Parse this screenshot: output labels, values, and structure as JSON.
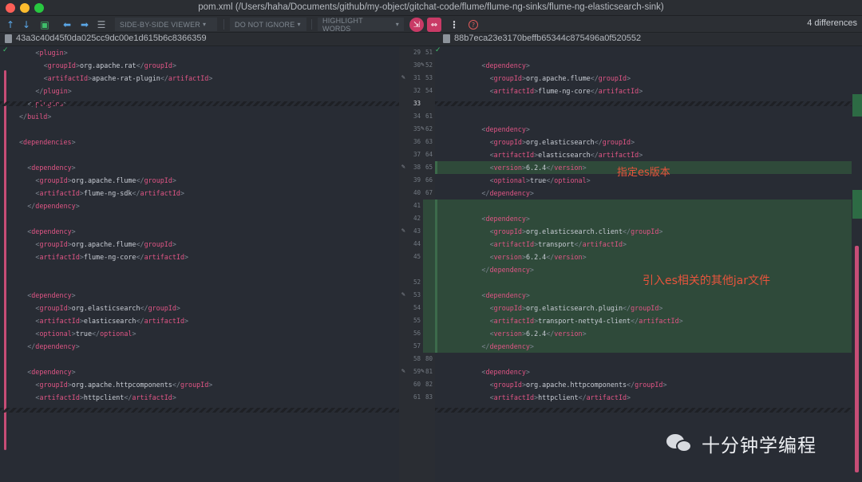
{
  "window": {
    "title": "pom.xml (/Users/haha/Documents/github/my-object/gitchat-code/flume/flume-ng-sinks/flume-ng-elasticsearch-sink)"
  },
  "toolbar": {
    "viewer_label": "SIDE-BY-SIDE VIEWER",
    "ignore_label": "DO NOT IGNORE",
    "highlight_label": "HIGHLIGHT WORDS",
    "diff_count": "4 differences"
  },
  "revisions": {
    "left_hash": "43a3c40d45f0da025cc9dc00e1d615b6c8366359",
    "right_hash": "88b7eca23e3170beffb65344c875496a0f520552"
  },
  "left_lines": [
    {
      "n": "29",
      "indent": 4,
      "parts": [
        [
          "<",
          "br"
        ],
        [
          "plugin",
          "tag"
        ],
        [
          ">",
          "br"
        ]
      ]
    },
    {
      "n": "30",
      "indent": 6,
      "parts": [
        [
          "<",
          "br"
        ],
        [
          "groupId",
          "tag"
        ],
        [
          ">",
          "br"
        ],
        [
          "org.apache.rat",
          "txt"
        ],
        [
          "</",
          "br"
        ],
        [
          "groupId",
          "tag"
        ],
        [
          ">",
          "br"
        ]
      ]
    },
    {
      "n": "31",
      "indent": 6,
      "parts": [
        [
          "<",
          "br"
        ],
        [
          "artifactId",
          "tag"
        ],
        [
          ">",
          "br"
        ],
        [
          "apache-rat-plugin",
          "txt"
        ],
        [
          "</",
          "br"
        ],
        [
          "artifactId",
          "tag"
        ],
        [
          ">",
          "br"
        ]
      ]
    },
    {
      "n": "32",
      "indent": 4,
      "parts": [
        [
          "</",
          "br"
        ],
        [
          "plugin",
          "tag"
        ],
        [
          ">",
          "br"
        ]
      ]
    },
    {
      "n": "33",
      "indent": 2,
      "parts": [
        [
          "</",
          "br"
        ],
        [
          "plugins",
          "tag"
        ],
        [
          ">",
          "br"
        ]
      ]
    },
    {
      "n": "34",
      "indent": 0,
      "parts": [
        [
          "</",
          "br"
        ],
        [
          "build",
          "tag"
        ],
        [
          ">",
          "br"
        ]
      ]
    },
    {
      "n": "35",
      "indent": 0,
      "parts": []
    },
    {
      "n": "36",
      "indent": 0,
      "parts": [
        [
          "<",
          "br"
        ],
        [
          "dependencies",
          "tag"
        ],
        [
          ">",
          "br"
        ]
      ]
    },
    {
      "n": "37",
      "indent": 0,
      "parts": []
    },
    {
      "n": "38",
      "indent": 2,
      "parts": [
        [
          "<",
          "br"
        ],
        [
          "dependency",
          "tag"
        ],
        [
          ">",
          "br"
        ]
      ]
    },
    {
      "n": "39",
      "indent": 4,
      "parts": [
        [
          "<",
          "br"
        ],
        [
          "groupId",
          "tag"
        ],
        [
          ">",
          "br"
        ],
        [
          "org.apache.flume",
          "txt"
        ],
        [
          "</",
          "br"
        ],
        [
          "groupId",
          "tag"
        ],
        [
          ">",
          "br"
        ]
      ]
    },
    {
      "n": "40",
      "indent": 4,
      "parts": [
        [
          "<",
          "br"
        ],
        [
          "artifactId",
          "tag"
        ],
        [
          ">",
          "br"
        ],
        [
          "flume-ng-sdk",
          "txt"
        ],
        [
          "</",
          "br"
        ],
        [
          "artifactId",
          "tag"
        ],
        [
          ">",
          "br"
        ]
      ]
    },
    {
      "n": "41",
      "indent": 2,
      "parts": [
        [
          "</",
          "br"
        ],
        [
          "dependency",
          "tag"
        ],
        [
          ">",
          "br"
        ]
      ]
    },
    {
      "n": "42",
      "indent": 0,
      "parts": []
    },
    {
      "n": "43",
      "indent": 2,
      "parts": [
        [
          "<",
          "br"
        ],
        [
          "dependency",
          "tag"
        ],
        [
          ">",
          "br"
        ]
      ]
    },
    {
      "n": "44",
      "indent": 4,
      "parts": [
        [
          "<",
          "br"
        ],
        [
          "groupId",
          "tag"
        ],
        [
          ">",
          "br"
        ],
        [
          "org.apache.flume",
          "txt"
        ],
        [
          "</",
          "br"
        ],
        [
          "groupId",
          "tag"
        ],
        [
          ">",
          "br"
        ]
      ]
    },
    {
      "n": "45",
      "indent": 4,
      "parts": [
        [
          "<",
          "br"
        ],
        [
          "artifactId",
          "tag"
        ],
        [
          ">",
          "br"
        ],
        [
          "flume-ng-core",
          "txt"
        ],
        [
          "</",
          "br"
        ],
        [
          "artifactId",
          "tag"
        ],
        [
          ">",
          "br"
        ]
      ]
    },
    {
      "n": "",
      "indent": 0,
      "parts": []
    },
    {
      "n": "52",
      "indent": 0,
      "parts": []
    },
    {
      "n": "53",
      "indent": 2,
      "parts": [
        [
          "<",
          "br"
        ],
        [
          "dependency",
          "tag"
        ],
        [
          ">",
          "br"
        ]
      ]
    },
    {
      "n": "54",
      "indent": 4,
      "parts": [
        [
          "<",
          "br"
        ],
        [
          "groupId",
          "tag"
        ],
        [
          ">",
          "br"
        ],
        [
          "org.elasticsearch",
          "txt"
        ],
        [
          "</",
          "br"
        ],
        [
          "groupId",
          "tag"
        ],
        [
          ">",
          "br"
        ]
      ]
    },
    {
      "n": "55",
      "indent": 4,
      "parts": [
        [
          "<",
          "br"
        ],
        [
          "artifactId",
          "tag"
        ],
        [
          ">",
          "br"
        ],
        [
          "elasticsearch",
          "txt"
        ],
        [
          "</",
          "br"
        ],
        [
          "artifactId",
          "tag"
        ],
        [
          ">",
          "br"
        ]
      ]
    },
    {
      "n": "56",
      "indent": 4,
      "parts": [
        [
          "<",
          "br"
        ],
        [
          "optional",
          "tag"
        ],
        [
          ">",
          "br"
        ],
        [
          "true",
          "txt"
        ],
        [
          "</",
          "br"
        ],
        [
          "optional",
          "tag"
        ],
        [
          ">",
          "br"
        ]
      ]
    },
    {
      "n": "57",
      "indent": 2,
      "parts": [
        [
          "</",
          "br"
        ],
        [
          "dependency",
          "tag"
        ],
        [
          ">",
          "br"
        ]
      ]
    },
    {
      "n": "58",
      "indent": 0,
      "parts": []
    },
    {
      "n": "59",
      "indent": 2,
      "parts": [
        [
          "<",
          "br"
        ],
        [
          "dependency",
          "tag"
        ],
        [
          ">",
          "br"
        ]
      ]
    },
    {
      "n": "60",
      "indent": 4,
      "parts": [
        [
          "<",
          "br"
        ],
        [
          "groupId",
          "tag"
        ],
        [
          ">",
          "br"
        ],
        [
          "org.apache.httpcomponents",
          "txt"
        ],
        [
          "</",
          "br"
        ],
        [
          "groupId",
          "tag"
        ],
        [
          ">",
          "br"
        ]
      ]
    },
    {
      "n": "61",
      "indent": 4,
      "parts": [
        [
          "<",
          "br"
        ],
        [
          "artifactId",
          "tag"
        ],
        [
          ">",
          "br"
        ],
        [
          "httpclient",
          "txt"
        ],
        [
          "</",
          "br"
        ],
        [
          "artifactId",
          "tag"
        ],
        [
          ">",
          "br"
        ]
      ]
    }
  ],
  "right_lines": [
    {
      "n": "51",
      "indent": 0,
      "parts": []
    },
    {
      "n": "52",
      "indent": 4,
      "parts": [
        [
          "<",
          "br"
        ],
        [
          "dependency",
          "tag"
        ],
        [
          ">",
          "br"
        ]
      ]
    },
    {
      "n": "53",
      "indent": 6,
      "parts": [
        [
          "<",
          "br"
        ],
        [
          "groupId",
          "tag"
        ],
        [
          ">",
          "br"
        ],
        [
          "org.apache.flume",
          "txt"
        ],
        [
          "</",
          "br"
        ],
        [
          "groupId",
          "tag"
        ],
        [
          ">",
          "br"
        ]
      ]
    },
    {
      "n": "54",
      "indent": 6,
      "parts": [
        [
          "<",
          "br"
        ],
        [
          "artifactId",
          "tag"
        ],
        [
          ">",
          "br"
        ],
        [
          "flume-ng-core",
          "txt"
        ],
        [
          "</",
          "br"
        ],
        [
          "artifactId",
          "tag"
        ],
        [
          ">",
          "br"
        ]
      ]
    },
    {
      "n": "",
      "indent": 0,
      "parts": []
    },
    {
      "n": "61",
      "indent": 0,
      "parts": []
    },
    {
      "n": "62",
      "indent": 4,
      "parts": [
        [
          "<",
          "br"
        ],
        [
          "dependency",
          "tag"
        ],
        [
          ">",
          "br"
        ]
      ]
    },
    {
      "n": "63",
      "indent": 6,
      "parts": [
        [
          "<",
          "br"
        ],
        [
          "groupId",
          "tag"
        ],
        [
          ">",
          "br"
        ],
        [
          "org.elasticsearch",
          "txt"
        ],
        [
          "</",
          "br"
        ],
        [
          "groupId",
          "tag"
        ],
        [
          ">",
          "br"
        ]
      ]
    },
    {
      "n": "64",
      "indent": 6,
      "parts": [
        [
          "<",
          "br"
        ],
        [
          "artifactId",
          "tag"
        ],
        [
          ">",
          "br"
        ],
        [
          "elasticsearch",
          "txt"
        ],
        [
          "</",
          "br"
        ],
        [
          "artifactId",
          "tag"
        ],
        [
          ">",
          "br"
        ]
      ]
    },
    {
      "n": "65",
      "indent": 6,
      "added": true,
      "parts": [
        [
          "<",
          "br"
        ],
        [
          "version",
          "tag"
        ],
        [
          ">",
          "br"
        ],
        [
          "6.2.4",
          "txt"
        ],
        [
          "</",
          "br"
        ],
        [
          "version",
          "tag"
        ],
        [
          ">",
          "br"
        ]
      ]
    },
    {
      "n": "66",
      "indent": 6,
      "parts": [
        [
          "<",
          "br"
        ],
        [
          "optional",
          "tag"
        ],
        [
          ">",
          "br"
        ],
        [
          "true",
          "txt"
        ],
        [
          "</",
          "br"
        ],
        [
          "optional",
          "tag"
        ],
        [
          ">",
          "br"
        ]
      ]
    },
    {
      "n": "67",
      "indent": 4,
      "parts": [
        [
          "</",
          "br"
        ],
        [
          "dependency",
          "tag"
        ],
        [
          ">",
          "br"
        ]
      ]
    },
    {
      "n": "68",
      "indent": 0,
      "added": true,
      "parts": []
    },
    {
      "n": "69",
      "indent": 4,
      "added": true,
      "parts": [
        [
          "<",
          "br"
        ],
        [
          "dependency",
          "tag"
        ],
        [
          ">",
          "br"
        ]
      ]
    },
    {
      "n": "70",
      "indent": 6,
      "added": true,
      "parts": [
        [
          "<",
          "br"
        ],
        [
          "groupId",
          "tag"
        ],
        [
          ">",
          "br"
        ],
        [
          "org.elasticsearch.client",
          "txt"
        ],
        [
          "</",
          "br"
        ],
        [
          "groupId",
          "tag"
        ],
        [
          ">",
          "br"
        ]
      ]
    },
    {
      "n": "71",
      "indent": 6,
      "added": true,
      "parts": [
        [
          "<",
          "br"
        ],
        [
          "artifactId",
          "tag"
        ],
        [
          ">",
          "br"
        ],
        [
          "transport",
          "txt"
        ],
        [
          "</",
          "br"
        ],
        [
          "artifactId",
          "tag"
        ],
        [
          ">",
          "br"
        ]
      ]
    },
    {
      "n": "72",
      "indent": 6,
      "added": true,
      "parts": [
        [
          "<",
          "br"
        ],
        [
          "version",
          "tag"
        ],
        [
          ">",
          "br"
        ],
        [
          "6.2.4",
          "txt"
        ],
        [
          "</",
          "br"
        ],
        [
          "version",
          "tag"
        ],
        [
          ">",
          "br"
        ]
      ]
    },
    {
      "n": "73",
      "indent": 4,
      "added": true,
      "parts": [
        [
          "</",
          "br"
        ],
        [
          "dependency",
          "tag"
        ],
        [
          ">",
          "br"
        ]
      ]
    },
    {
      "n": "74",
      "indent": 0,
      "added": true,
      "parts": []
    },
    {
      "n": "75",
      "indent": 4,
      "added": true,
      "parts": [
        [
          "<",
          "br"
        ],
        [
          "dependency",
          "tag"
        ],
        [
          ">",
          "br"
        ]
      ]
    },
    {
      "n": "76",
      "indent": 6,
      "added": true,
      "parts": [
        [
          "<",
          "br"
        ],
        [
          "groupId",
          "tag"
        ],
        [
          ">",
          "br"
        ],
        [
          "org.elasticsearch.plugin",
          "txt"
        ],
        [
          "</",
          "br"
        ],
        [
          "groupId",
          "tag"
        ],
        [
          ">",
          "br"
        ]
      ]
    },
    {
      "n": "77",
      "indent": 6,
      "added": true,
      "parts": [
        [
          "<",
          "br"
        ],
        [
          "artifactId",
          "tag"
        ],
        [
          ">",
          "br"
        ],
        [
          "transport-netty4-client",
          "txt"
        ],
        [
          "</",
          "br"
        ],
        [
          "artifactId",
          "tag"
        ],
        [
          ">",
          "br"
        ]
      ]
    },
    {
      "n": "78",
      "indent": 6,
      "added": true,
      "parts": [
        [
          "<",
          "br"
        ],
        [
          "version",
          "tag"
        ],
        [
          ">",
          "br"
        ],
        [
          "6.2.4",
          "txt"
        ],
        [
          "</",
          "br"
        ],
        [
          "version",
          "tag"
        ],
        [
          ">",
          "br"
        ]
      ]
    },
    {
      "n": "79",
      "indent": 4,
      "added": true,
      "parts": [
        [
          "</",
          "br"
        ],
        [
          "dependency",
          "tag"
        ],
        [
          ">",
          "br"
        ]
      ]
    },
    {
      "n": "80",
      "indent": 0,
      "parts": []
    },
    {
      "n": "81",
      "indent": 4,
      "parts": [
        [
          "<",
          "br"
        ],
        [
          "dependency",
          "tag"
        ],
        [
          ">",
          "br"
        ]
      ]
    },
    {
      "n": "82",
      "indent": 6,
      "parts": [
        [
          "<",
          "br"
        ],
        [
          "groupId",
          "tag"
        ],
        [
          ">",
          "br"
        ],
        [
          "org.apache.httpcomponents",
          "txt"
        ],
        [
          "</",
          "br"
        ],
        [
          "groupId",
          "tag"
        ],
        [
          ">",
          "br"
        ]
      ]
    },
    {
      "n": "83",
      "indent": 6,
      "parts": [
        [
          "<",
          "br"
        ],
        [
          "artifactId",
          "tag"
        ],
        [
          ">",
          "br"
        ],
        [
          "httpclient",
          "txt"
        ],
        [
          "</",
          "br"
        ],
        [
          "artifactId",
          "tag"
        ],
        [
          ">",
          "br"
        ]
      ]
    }
  ],
  "annotations": {
    "es_version": "指定es版本",
    "es_jars": "引入es相关的其他jar文件"
  },
  "watermark": {
    "text": "十分钟学编程"
  },
  "colors": {
    "tag": "#e05585",
    "added_bg": "#2f4a3a",
    "annotation": "#e8543c",
    "accent": "#c93a66"
  }
}
